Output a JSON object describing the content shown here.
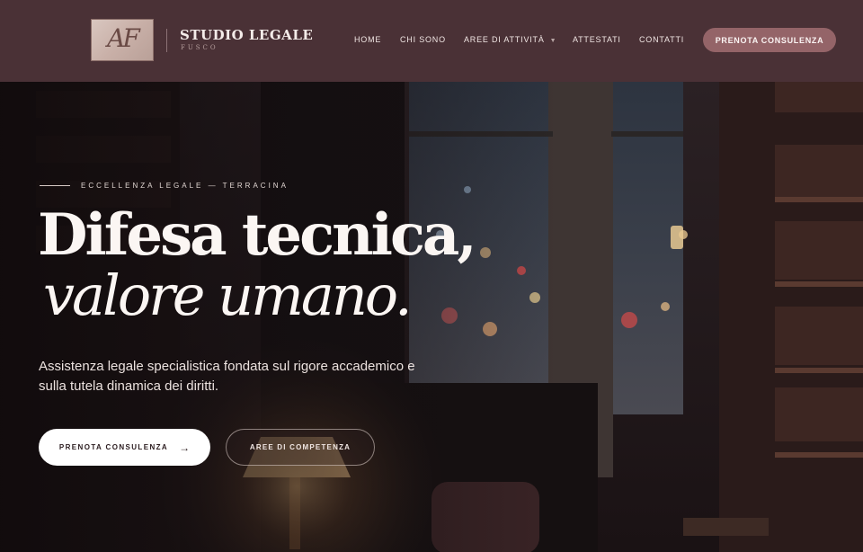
{
  "header": {
    "logo_monogram": "AF",
    "brand_name": "STUDIO LEGALE",
    "brand_sub": "FUSCO",
    "nav": [
      {
        "label": "HOME"
      },
      {
        "label": "CHI SONO"
      },
      {
        "label": "AREE DI ATTIVITÀ",
        "icon": "chevron-down-icon"
      },
      {
        "label": "ATTESTATI"
      },
      {
        "label": "CONTATTI"
      }
    ],
    "cta_label": "PRENOTA CONSULENZA"
  },
  "hero": {
    "eyebrow": "ECCELLENZA LEGALE — TERRACINA",
    "headline_line1": "Difesa tecnica,",
    "headline_line2": "valore umano.",
    "lede": "Assistenza legale specialistica fondata sul rigore accademico e sulla tutela dinamica dei diritti.",
    "primary_button": "PRENOTA CONSULENZA",
    "primary_button_icon": "arrow-right-icon",
    "secondary_button": "AREE DI COMPETENZA"
  },
  "colors": {
    "header_bg": "#4a3136",
    "cta_bg": "#946468",
    "hero_text": "#fbf6f3"
  }
}
